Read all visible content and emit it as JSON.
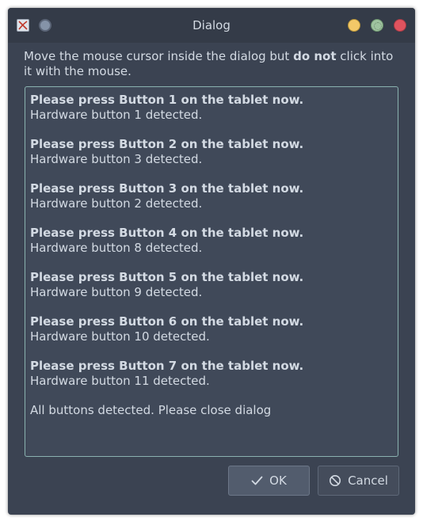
{
  "window": {
    "title": "Dialog"
  },
  "instruction": {
    "text_before": "Move the mouse cursor inside the dialog but ",
    "text_bold": "do not",
    "text_after": " click into it with the mouse."
  },
  "log": {
    "entries": [
      {
        "prompt": "Please press Button 1 on the tablet now.",
        "result": "Hardware button 1 detected."
      },
      {
        "prompt": "Please press Button 2 on the tablet now.",
        "result": "Hardware button 3 detected."
      },
      {
        "prompt": "Please press Button 3 on the tablet now.",
        "result": "Hardware button 2 detected."
      },
      {
        "prompt": "Please press Button 4 on the tablet now.",
        "result": "Hardware button 8 detected."
      },
      {
        "prompt": "Please press Button 5 on the tablet now.",
        "result": "Hardware button 9 detected."
      },
      {
        "prompt": "Please press Button 6 on the tablet now.",
        "result": "Hardware button 10 detected."
      },
      {
        "prompt": "Please press Button 7 on the tablet now.",
        "result": "Hardware button 11 detected."
      }
    ],
    "final_message": "All buttons detected. Please close dialog"
  },
  "buttons": {
    "ok_label": "OK",
    "ok_icon": "checkmark-icon",
    "cancel_label": "Cancel",
    "cancel_icon": "cancel-icon"
  },
  "colors": {
    "window_background": "#3b4352",
    "log_border": "#8ab2b0",
    "close_button": "#e0535e",
    "minimize_button": "#f3c868",
    "maximize_button": "#9fc4a0"
  }
}
